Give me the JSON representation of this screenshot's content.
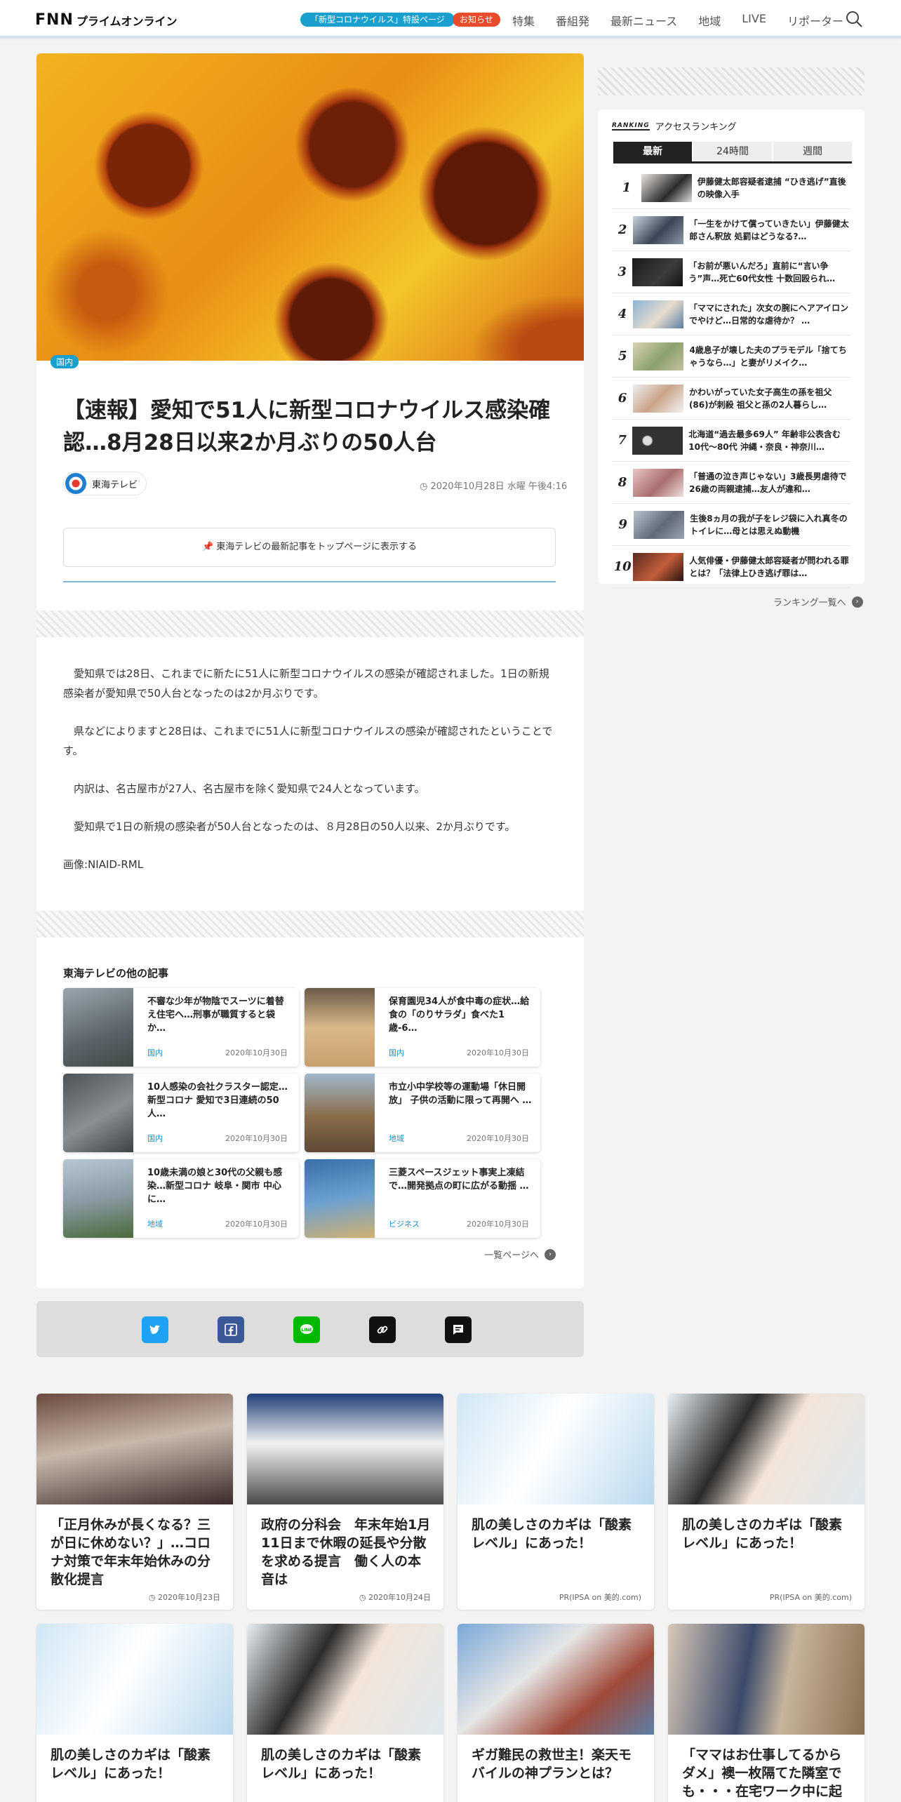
{
  "header": {
    "logo_main": "FNN",
    "logo_sub": "プライムオンライン",
    "corona_pill": "「新型コロナウイルス」特設ページ",
    "notice_pill": "お知らせ",
    "nav": [
      "特集",
      "番組発",
      "最新ニュース",
      "地域",
      "LIVE",
      "リポーター"
    ]
  },
  "article": {
    "category": "国内",
    "title": "【速報】愛知で51人に新型コロナウイルス感染確認…8月28日以来2か月ぶりの50人台",
    "source": "東海テレビ",
    "date": "2020年10月28日 水曜 午後4:16",
    "pin_text": "東海テレビの最新記事をトップページに表示する",
    "body": [
      "愛知県では28日、これまでに新たに51人に新型コロナウイルスの感染が確認されました。1日の新規感染者が愛知県で50人台となったのは2か月ぶりです。",
      "県などによりますと28日は、これまでに51人に新型コロナウイルスの感染が確認されたということです。",
      "内訳は、名古屋市が27人、名古屋市を除く愛知県で24人となっています。",
      "愛知県で1日の新規の感染者が50人台となったのは、８月28日の50人以来、2か月ぶりです。"
    ],
    "credit": "画像:NIAID-RML",
    "related_heading": "東海テレビの他の記事",
    "related": [
      {
        "title": "不審な少年が物陰でスーツに着替え住宅へ…刑事が職質すると袋か…",
        "cat": "国内",
        "date": "2020年10月30日"
      },
      {
        "title": "保育園児34人が食中毒の症状…給食の「のりサラダ」食べた1歳-6…",
        "cat": "国内",
        "date": "2020年10月30日"
      },
      {
        "title": "10人感染の会社クラスター認定…新型コロナ 愛知で3日連続の50人…",
        "cat": "国内",
        "date": "2020年10月30日"
      },
      {
        "title": "市立小中学校等の運動場「休日開放」 子供の活動に限って再開へ …",
        "cat": "地域",
        "date": "2020年10月30日"
      },
      {
        "title": "10歳未満の娘と30代の父親も感染…新型コロナ 岐阜・関市 中心に…",
        "cat": "地域",
        "date": "2020年10月30日"
      },
      {
        "title": "三菱スペースジェット事実上凍結で…開発拠点の町に広がる動揺 …",
        "cat": "ビジネス",
        "date": "2020年10月30日"
      }
    ],
    "more_label": "一覧ページへ"
  },
  "ranking": {
    "tag": "RANKING",
    "heading": "アクセスランキング",
    "tabs": [
      "最新",
      "24時間",
      "週間"
    ],
    "items": [
      "伊藤健太郎容疑者逮捕 “ひき逃げ”直後の映像入手",
      "「一生をかけて償っていきたい」伊藤健太郎さん釈放 処罰はどうなる?…",
      "「お前が悪いんだろ」直前に“言い争う”声…死亡60代女性 十数回殴られ…",
      "「ママにされた」次女の腕にヘアアイロンでやけど…日常的な虐待か？ …",
      "4歳息子が壊した夫のプラモデル「捨てちゃうなら…」と妻がリメイク…",
      "かわいがっていた女子高生の孫を祖父(86)が刺殺 祖父と孫の2人暮らし…",
      "北海道“過去最多69人” 年齢非公表含む10代〜80代 沖縄・奈良・神奈川…",
      "「普通の泣き声じゃない」3歳長男虐待で26歳の両親逮捕…友人が違和…",
      "生後8ヵ月の我が子をレジ袋に入れ真冬のトイレに…母とは思えぬ動機",
      "人気俳優・伊藤健太郎容疑者が問われる罪とは？「法律上ひき逃げ罪は…"
    ],
    "more_label": "ランキング一覧へ"
  },
  "bottom": [
    {
      "title": "「正月休みが長くなる？三が日に休めない？」…コロナ対策で年末年始休みの分散化提言",
      "foot": "2020年10月23日"
    },
    {
      "title": "政府の分科会　年末年始1月11日まで休暇の延長や分散を求める提言　働く人の本音は",
      "foot": "2020年10月24日"
    },
    {
      "title": "肌の美しさのカギは「酸素レベル」にあった！",
      "foot": "PR(IPSA on 美的.com)"
    },
    {
      "title": "肌の美しさのカギは「酸素レベル」にあった！",
      "foot": "PR(IPSA on 美的.com)"
    },
    {
      "title": "肌の美しさのカギは「酸素レベル」にあった！",
      "foot": ""
    },
    {
      "title": "肌の美しさのカギは「酸素レベル」にあった！",
      "foot": ""
    },
    {
      "title": "ギガ難民の救世主！楽天モバイルの神プランとは？",
      "foot": ""
    },
    {
      "title": "「ママはお仕事してるからダメ」襖一枚隔てた隣室でも・・・在宅ワーク中に起きた…",
      "foot": ""
    }
  ],
  "colors": {
    "accent": "#1aa0cf",
    "notice": "#e94b2d"
  }
}
